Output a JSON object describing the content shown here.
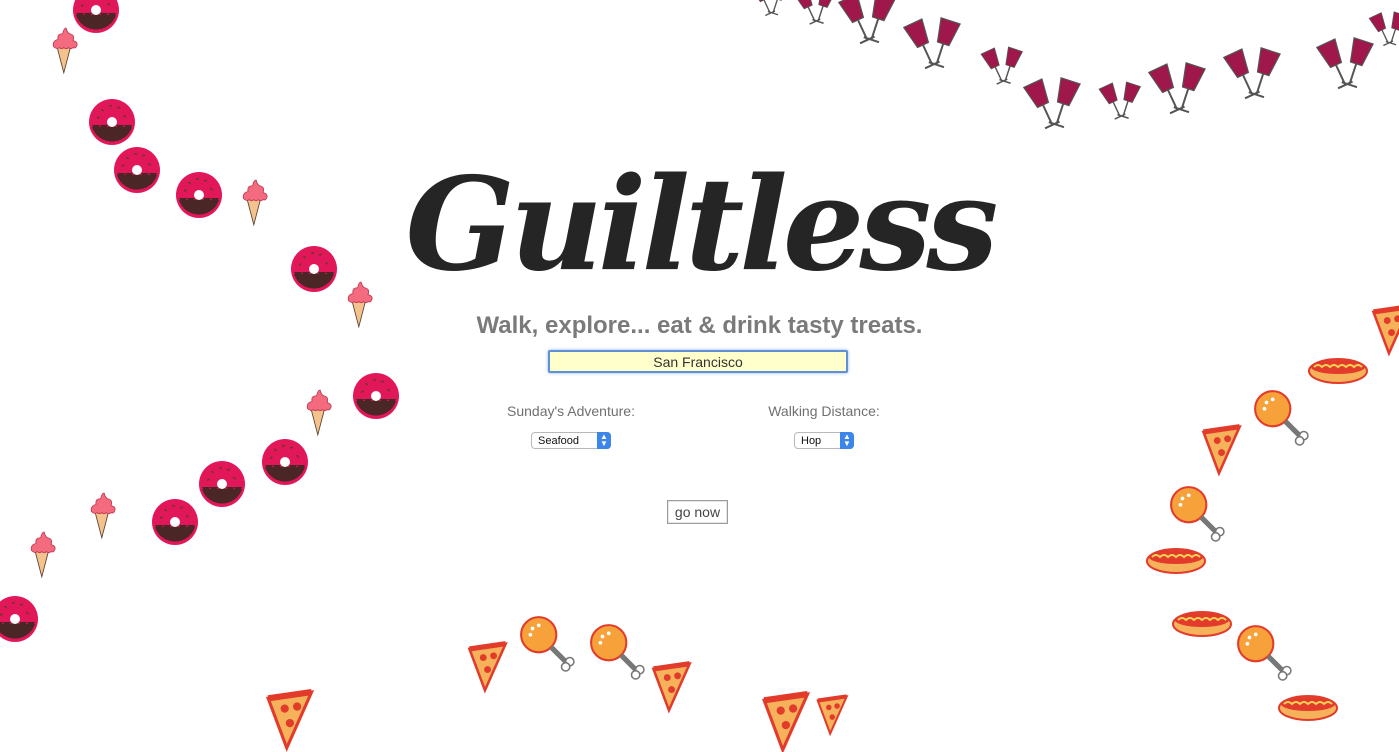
{
  "hero": {
    "logo": "Guiltless",
    "tagline": "Walk, explore... eat & drink tasty treats."
  },
  "search": {
    "city_value": "San Francisco"
  },
  "form": {
    "adventure_label": "Sunday's Adventure:",
    "adventure_selected": "Seafood",
    "distance_label": "Walking Distance:",
    "distance_selected": "Hop",
    "go_label": "go now"
  },
  "decorations": [
    "donut-icon",
    "ice-cream-icon",
    "wine-glasses-icon",
    "pizza-icon",
    "chicken-leg-icon",
    "hot-dog-icon"
  ],
  "colors": {
    "logo": "#252525",
    "tagline": "#7a7a7a",
    "input_bg": "#ffffcc",
    "input_border": "#5f8fd4",
    "select_arrow": "#3b86e8",
    "wine": "#a0174b",
    "donut_frosting": "#e2175a",
    "ice_cream": "#f46a7e",
    "food_orange": "#f08a24"
  }
}
